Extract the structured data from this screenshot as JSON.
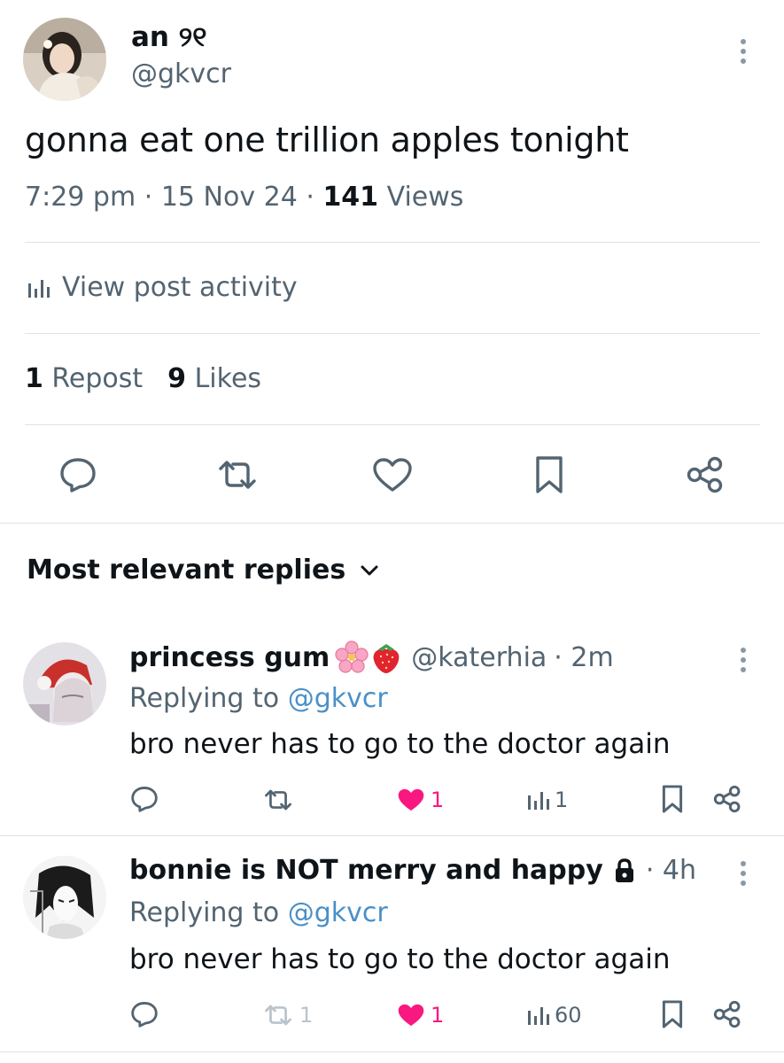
{
  "post": {
    "display_name": "an ୨୧",
    "handle": "@gkvcr",
    "text": "gonna eat one trillion apples tonight",
    "time": "7:29 pm",
    "date": "15 Nov 24",
    "views_count": "141",
    "views_label": "Views",
    "meta_sep": "·",
    "activity_label": "View post activity",
    "reposts_count": "1",
    "reposts_label": "Repost",
    "likes_count": "9",
    "likes_label": "Likes",
    "icons": [
      "reply-icon",
      "repost-icon",
      "like-icon",
      "bookmark-icon",
      "share-icon"
    ]
  },
  "replies_section": {
    "heading": "Most relevant replies"
  },
  "replies": [
    {
      "display_name": "princess gum",
      "emoji": [
        "cherry-blossom",
        "strawberry"
      ],
      "handle": "@katerhia",
      "age": "· 2m",
      "replying_prefix": "Replying to",
      "replying_handle": "@gkvcr",
      "text": "bro never has to go to the doctor again",
      "reposts": "",
      "likes": "1",
      "views": "1"
    },
    {
      "display_name": "bonnie is NOT merry and happy",
      "badge": "lock-icon",
      "age": "· 4h",
      "replying_prefix": "Replying to",
      "replying_handle": "@gkvcr",
      "text": "bro never has to go to the doctor again",
      "reposts": "1",
      "likes": "1",
      "views": "60"
    }
  ],
  "colors": {
    "text": "#0f1419",
    "muted": "#536471",
    "link": "#4a90c8",
    "like": "#f91880",
    "divider": "#dfe3e6"
  }
}
